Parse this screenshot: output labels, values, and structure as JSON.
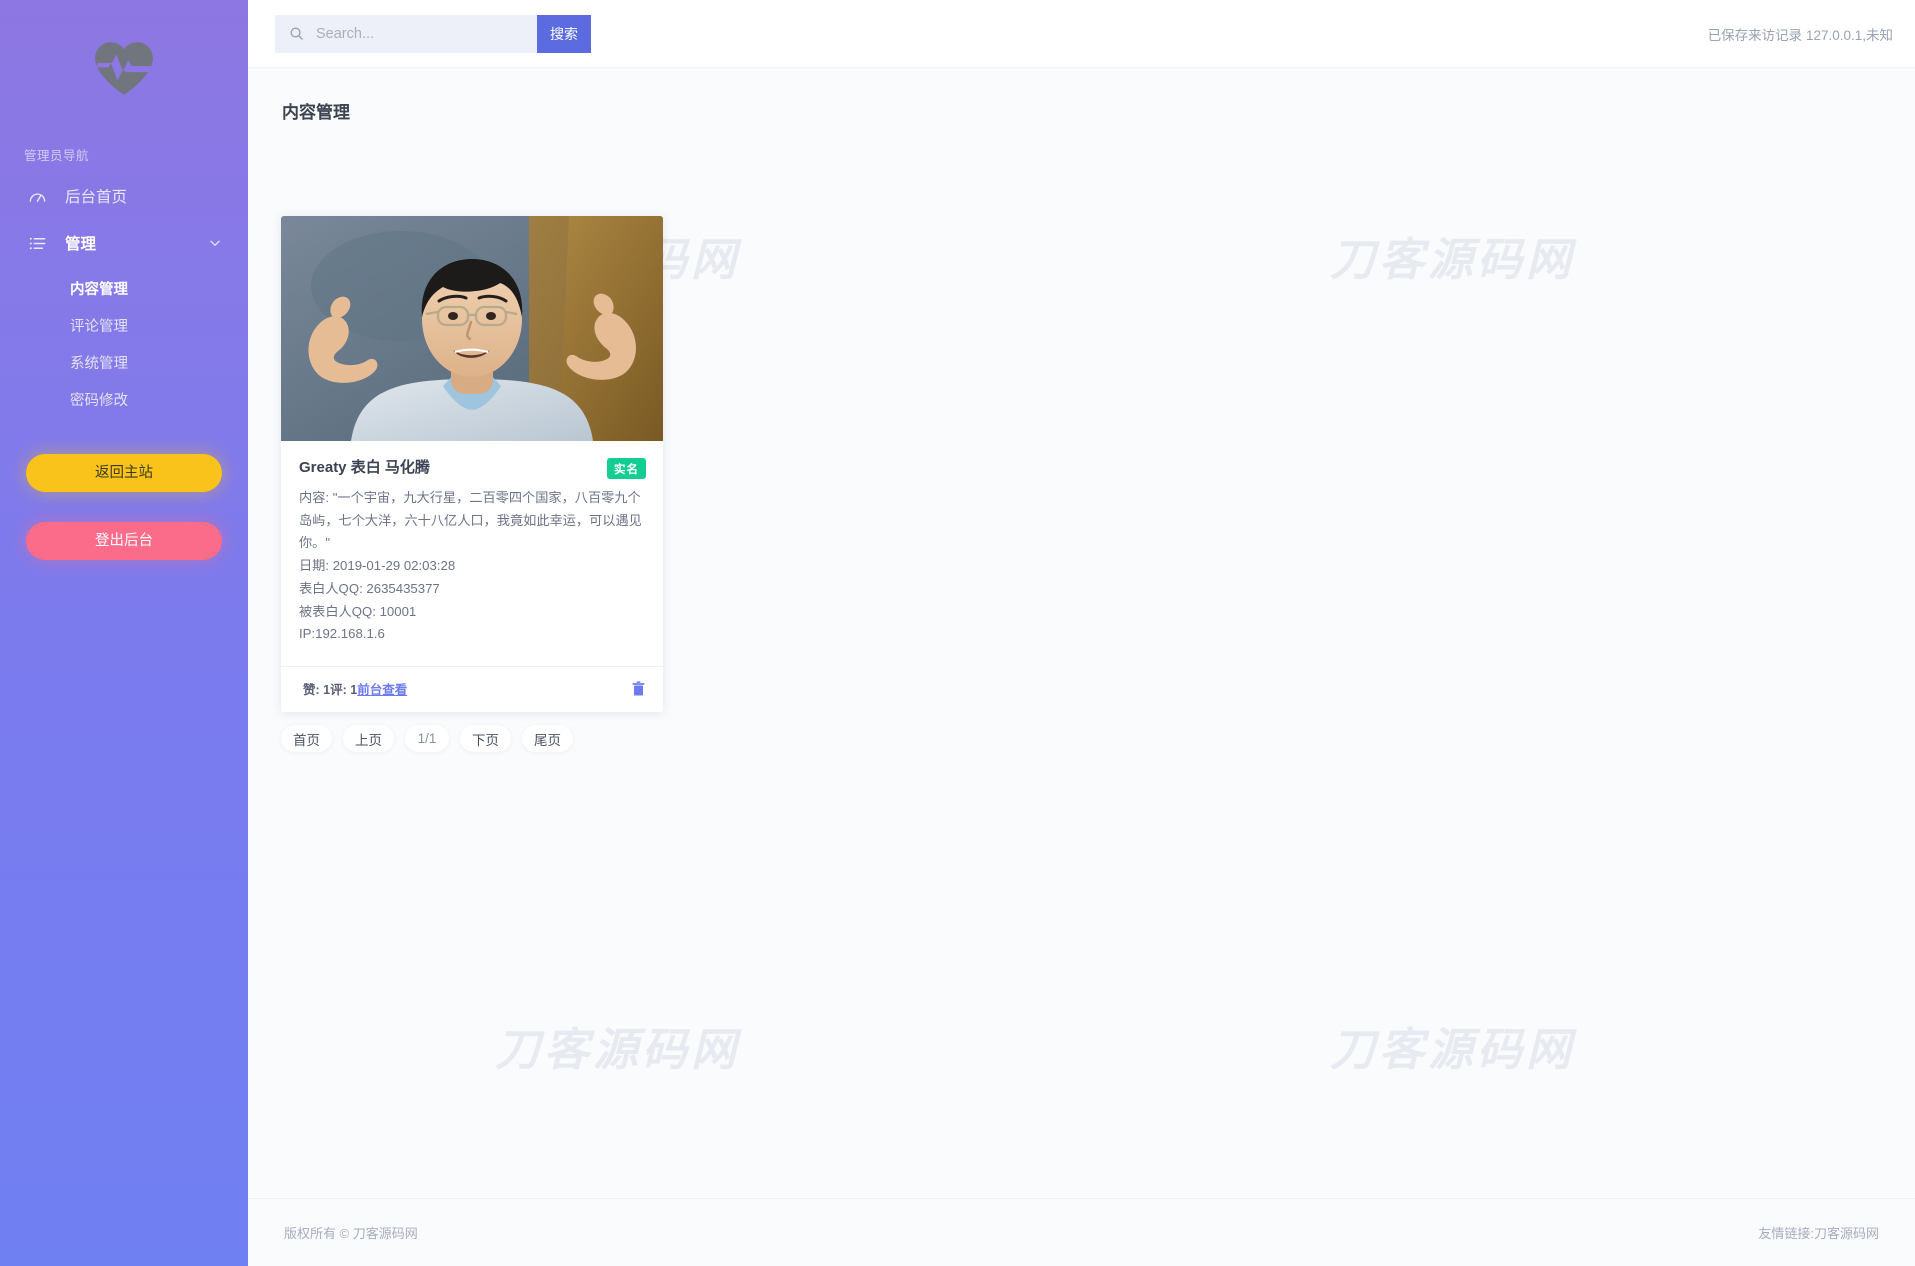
{
  "sidebar": {
    "logo_icon": "heartbeat-logo-icon",
    "nav_title": "管理员导航",
    "items": [
      {
        "label": "后台首页",
        "icon": "pulse-chart-icon"
      },
      {
        "label": "管理",
        "icon": "list-icon",
        "chevron": "chevron-down-icon"
      }
    ],
    "subitems": [
      {
        "label": "内容管理",
        "active": true
      },
      {
        "label": "评论管理",
        "active": false
      },
      {
        "label": "系统管理",
        "active": false
      },
      {
        "label": "密码修改",
        "active": false
      }
    ],
    "buttons": {
      "back_to_site": "返回主站",
      "logout": "登出后台"
    }
  },
  "topbar": {
    "search_placeholder": "Search...",
    "search_value": "",
    "search_button": "搜索",
    "search_icon": "search-icon",
    "visit_note": "已保存来访记录 127.0.0.1,未知"
  },
  "main": {
    "page_title": "内容管理",
    "watermark": "刀客源码网"
  },
  "card": {
    "photo_alt": "人物照片",
    "title": "Greaty 表白 马化腾",
    "badge": "实名",
    "content": "内容: \"一个宇宙，九大行星，二百零四个国家，八百零九个岛屿，七个大洋，六十八亿人口，我竟如此幸运，可以遇见你。\"",
    "date": "日期: 2019-01-29 02:03:28",
    "sender_qq": "表白人QQ: 2635435377",
    "receiver_qq": "被表白人QQ: 10001",
    "ip": "IP:192.168.1.6",
    "stats": "赞: 1评: 1",
    "view_link": "前台查看",
    "delete_icon": "trash-icon"
  },
  "pagination": {
    "first": "首页",
    "prev": "上页",
    "current": "1/1",
    "next": "下页",
    "last": "尾页"
  },
  "footer": {
    "copyright": "版权所有 © 刀客源码网",
    "friend_link": "友情链接:刀客源码网"
  },
  "colors": {
    "sidebar_top": "#8d77e2",
    "sidebar_bottom": "#6f80f2",
    "accent": "#5C6BE0",
    "badge_green": "#13CE92",
    "btn_yellow": "#F9C31B",
    "btn_pink": "#FB6C8A",
    "link": "#6E7BEE"
  }
}
